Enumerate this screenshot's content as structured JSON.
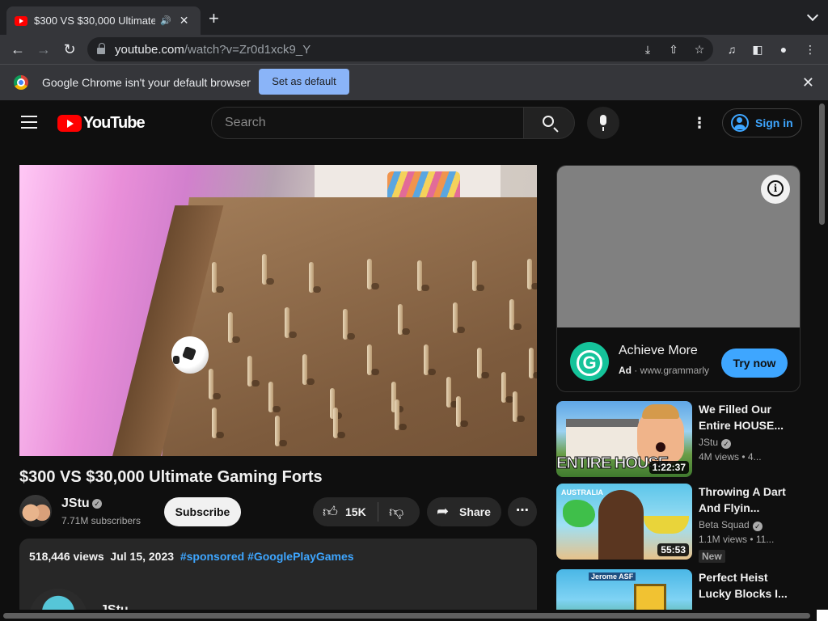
{
  "browser": {
    "tab_title": "$300 VS $30,000 Ultimate",
    "url_host": "youtube.com",
    "url_path": "/watch?v=Zr0d1xck9_Y",
    "infobar_text": "Google Chrome isn't your default browser",
    "infobar_button": "Set as default"
  },
  "masthead": {
    "logo_text": "YouTube",
    "search_placeholder": "Search",
    "signin_label": "Sign in"
  },
  "video": {
    "title": "$300 VS $30,000 Ultimate Gaming Forts",
    "channel": "JStu",
    "subscribers": "7.71M subscribers",
    "subscribe_label": "Subscribe",
    "likes": "15K",
    "share_label": "Share",
    "views": "518,446 views",
    "date": "Jul 15, 2023",
    "hashtags": [
      "#sponsored",
      "#GooglePlayGames"
    ],
    "desc_channel": "JStu"
  },
  "ad": {
    "headline": "Achieve More",
    "ad_label": "Ad",
    "domain": "www.grammarly",
    "cta": "Try now",
    "logo_letter": "G"
  },
  "recommendations": [
    {
      "title": "We Filled Our Entire HOUSE...",
      "channel": "JStu",
      "stats": "4M views  • 4...",
      "duration": "1:22:37",
      "thumb_text": "ENTIRE HOUSE",
      "badge": ""
    },
    {
      "title": "Throwing A Dart And Flyin...",
      "channel": "Beta Squad",
      "stats": "1.1M views  • 11...",
      "duration": "55:53",
      "thumb_text": "AUSTRALIA",
      "badge": "New"
    },
    {
      "title": "Perfect Heist Lucky Blocks I...",
      "channel": "",
      "stats": "",
      "duration": "",
      "thumb_text": "Jerome ASF",
      "badge": ""
    }
  ]
}
